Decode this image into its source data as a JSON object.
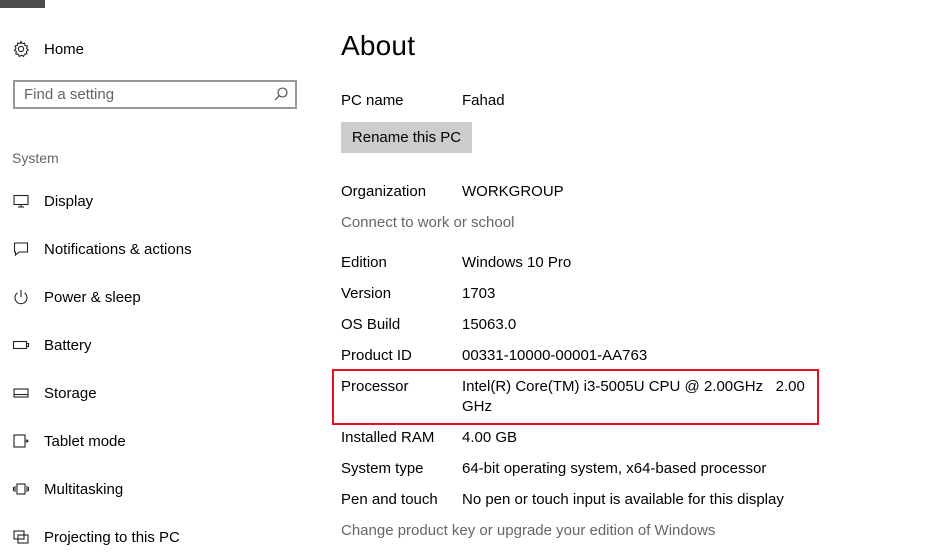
{
  "sidebar": {
    "home_label": "Home",
    "search_placeholder": "Find a setting",
    "section_label": "System",
    "items": [
      {
        "label": "Display",
        "icon": "display-icon"
      },
      {
        "label": "Notifications & actions",
        "icon": "notifications-icon"
      },
      {
        "label": "Power & sleep",
        "icon": "power-icon"
      },
      {
        "label": "Battery",
        "icon": "battery-icon"
      },
      {
        "label": "Storage",
        "icon": "storage-icon"
      },
      {
        "label": "Tablet mode",
        "icon": "tablet-mode-icon"
      },
      {
        "label": "Multitasking",
        "icon": "multitasking-icon"
      },
      {
        "label": "Projecting to this PC",
        "icon": "projecting-icon"
      }
    ]
  },
  "main": {
    "title": "About",
    "pc_name_label": "PC name",
    "pc_name_value": "Fahad",
    "rename_button": "Rename this PC",
    "organization_label": "Organization",
    "organization_value": "WORKGROUP",
    "connect_link": "Connect to work or school",
    "specs": {
      "edition_label": "Edition",
      "edition_value": "Windows 10 Pro",
      "version_label": "Version",
      "version_value": "1703",
      "os_build_label": "OS Build",
      "os_build_value": "15063.0",
      "product_id_label": "Product ID",
      "product_id_value": "00331-10000-00001-AA763",
      "processor_label": "Processor",
      "processor_value_line1": "Intel(R) Core(TM) i3-5005U CPU @ 2.00GHz   2.00",
      "processor_value_line2": "GHz",
      "ram_label": "Installed RAM",
      "ram_value": "4.00 GB",
      "system_type_label": "System type",
      "system_type_value": "64-bit operating system, x64-based processor",
      "pen_touch_label": "Pen and touch",
      "pen_touch_value": "No pen or touch input is available for this display"
    },
    "product_key_link": "Change product key or upgrade your edition of Windows"
  },
  "colors": {
    "highlight_border": "#e81123",
    "button_bg": "#cccccc",
    "secondary_text": "#666666"
  }
}
